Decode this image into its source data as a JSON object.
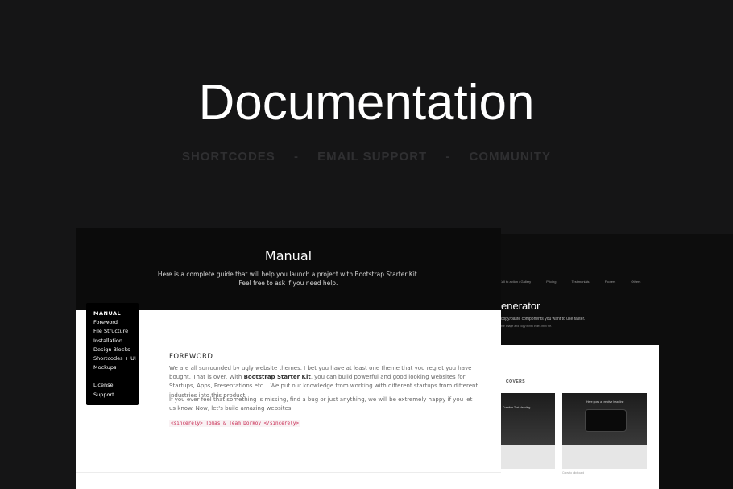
{
  "hero": {
    "title": "Documentation",
    "nav": [
      "SHORTCODES",
      "EMAIL SUPPORT",
      "COMMUNITY"
    ],
    "separator": "-"
  },
  "manual": {
    "title": "Manual",
    "description_line1": "Here is a complete guide that will help you launch a project with Bootstrap Starter Kit.",
    "description_line2": "Feel free to ask if you need help."
  },
  "sidebar": {
    "items": [
      "MANUAL",
      "Foreword",
      "File Structure",
      "Installation",
      "Design Blocks",
      "Shortcodes + UI",
      "Mockups"
    ],
    "secondary_items": [
      "License",
      "Support"
    ]
  },
  "foreword": {
    "heading": "FOREWORD",
    "p1_part1": "We are all surrounded by ugly website themes. I bet you have at least one theme that you regret you have bought. That is over. With ",
    "p1_bold": "Bootstrap Starter Kit",
    "p1_part2": ", you can build powerful and good looking websites for Startups, Apps, Presentations etc... We put our knowledge from working with different startups from different industries into this product.",
    "p2": "If you ever feel that something is missing, find a bug or just anything, we will be extremely happy if you let us know. Now, let's build amazing websites",
    "signature": "<sincerely> Tomas & Team Dorkoy </sincerely>"
  },
  "background_page": {
    "nav": [
      "Call to action / Gallery",
      "Pricing",
      "Testimonials",
      "Footers",
      "Others"
    ],
    "heading": "enerator",
    "subtext": "copy/paste components you want to use faster.",
    "subtext2": "the image and copy it into index.html file.",
    "section_label": "COVERS",
    "thumb1_caption": "Creative Text Heading",
    "thumb2_caption": "Here goes a creative headline",
    "copy_label": "Copy to clipboard"
  },
  "colors": {
    "background": "#151516",
    "nav_text": "#2f2f31",
    "code_text": "#c7254e",
    "sidebar_bg": "#000000"
  }
}
